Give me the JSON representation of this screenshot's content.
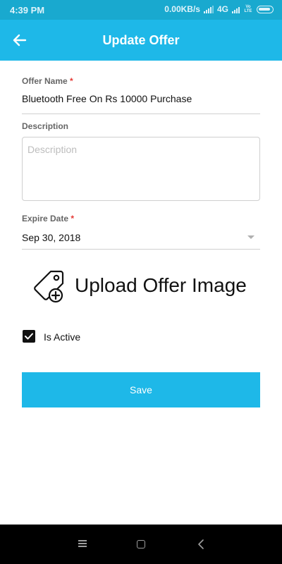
{
  "status_bar": {
    "time": "4:39 PM",
    "network_speed": "0.00KB/s",
    "network_type": "4G",
    "volte_label": "Vo LTE"
  },
  "app_bar": {
    "title": "Update Offer",
    "back_icon": "arrow-left-icon"
  },
  "form": {
    "offer_name": {
      "label": "Offer Name",
      "required_mark": "*",
      "value": "Bluetooth Free On Rs 10000 Purchase"
    },
    "description": {
      "label": "Description",
      "placeholder": "Description",
      "value": ""
    },
    "expire_date": {
      "label": "Expire Date",
      "required_mark": "*",
      "value": "Sep 30, 2018"
    },
    "upload": {
      "label": "Upload Offer Image",
      "icon": "tag-add-icon"
    },
    "is_active": {
      "label": "Is Active",
      "checked": true
    },
    "save_label": "Save"
  },
  "colors": {
    "status_bar": "#19a9cf",
    "primary": "#1eb8e8",
    "required": "#e53935"
  },
  "nav_bar": {
    "icons": [
      "menu-icon",
      "home-square-icon",
      "back-chevron-icon"
    ]
  }
}
